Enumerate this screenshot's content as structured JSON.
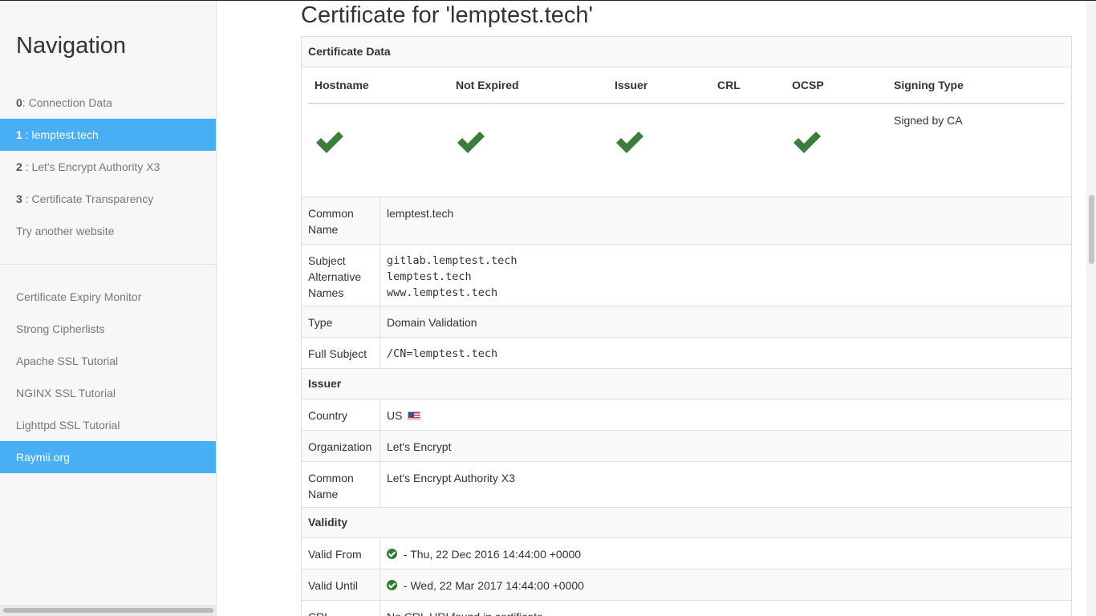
{
  "sidebar": {
    "title": "Navigation",
    "items": [
      {
        "num": "0",
        "sep": ": ",
        "label": "Connection Data",
        "active": false
      },
      {
        "num": "1",
        "sep": " : ",
        "label": "lemptest.tech",
        "active": true
      },
      {
        "num": "2",
        "sep": " : ",
        "label": "Let's Encrypt Authority X3",
        "active": false
      },
      {
        "num": "3",
        "sep": " : ",
        "label": "Certificate Transparency",
        "active": false
      },
      {
        "label": "Try another website",
        "active": false
      }
    ],
    "links": [
      {
        "label": "Certificate Expiry Monitor",
        "active": false
      },
      {
        "label": "Strong Cipherlists",
        "active": false
      },
      {
        "label": "Apache SSL Tutorial",
        "active": false
      },
      {
        "label": "NGINX SSL Tutorial",
        "active": false
      },
      {
        "label": "Lighttpd SSL Tutorial",
        "active": false
      },
      {
        "label": "Raymii.org",
        "active": true
      }
    ]
  },
  "page_title": "Certificate for 'lemptest.tech'",
  "cert": {
    "section_data": "Certificate Data",
    "status_headers": [
      "Hostname",
      "Not Expired",
      "Issuer",
      "CRL",
      "OCSP",
      "Signing Type"
    ],
    "status_checks": {
      "hostname": true,
      "not_expired": true,
      "issuer": true,
      "crl": false,
      "ocsp": true
    },
    "signing_type": "Signed by CA",
    "common_name_label": "Common Name",
    "common_name": "lemptest.tech",
    "san_label": "Subject Alternative Names",
    "san": [
      "gitlab.lemptest.tech",
      "lemptest.tech",
      "www.lemptest.tech"
    ],
    "type_label": "Type",
    "type": "Domain Validation",
    "full_subject_label": "Full Subject",
    "full_subject": "/CN=lemptest.tech",
    "section_issuer": "Issuer",
    "country_label": "Country",
    "country": "US",
    "organization_label": "Organization",
    "organization": "Let's Encrypt",
    "issuer_cn_label": "Common Name",
    "issuer_cn": "Let's Encrypt Authority X3",
    "section_validity": "Validity",
    "valid_from_label": "Valid From",
    "valid_from": " - Thu, 22 Dec 2016 14:44:00 +0000",
    "valid_until_label": "Valid Until",
    "valid_until": " - Wed, 22 Mar 2017 14:44:00 +0000",
    "crl_label": "CRL",
    "crl": "No CRL URI found in certificate"
  },
  "colors": {
    "accent": "#48aff5",
    "ok": "#2e7d32"
  }
}
